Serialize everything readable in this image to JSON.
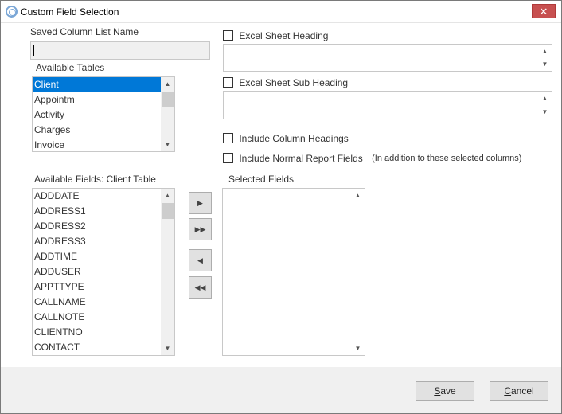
{
  "window": {
    "title": "Custom Field Selection",
    "close_glyph": "✕"
  },
  "saved_list": {
    "label": "Saved Column List Name",
    "value": ""
  },
  "tables": {
    "label": "Available Tables",
    "items": [
      "Client",
      "Appointm",
      "Activity",
      "Charges",
      "Invoice"
    ],
    "selected": "Client"
  },
  "fields": {
    "label": "Available Fields: Client Table",
    "items": [
      "ADDDATE",
      "ADDRESS1",
      "ADDRESS2",
      "ADDRESS3",
      "ADDTIME",
      "ADDUSER",
      "APPTTYPE",
      "CALLNAME",
      "CALLNOTE",
      "CLIENTNO",
      "CONTACT"
    ]
  },
  "selected_fields": {
    "label": "Selected Fields",
    "items": []
  },
  "options": {
    "excel_heading": {
      "label": "Excel Sheet Heading",
      "checked": false,
      "value": ""
    },
    "excel_sub_heading": {
      "label": "Excel Sheet Sub Heading",
      "checked": false,
      "value": ""
    },
    "include_column_headings": {
      "label": "Include Column Headings",
      "checked": false
    },
    "include_normal_fields": {
      "label": "Include Normal Report Fields",
      "checked": false,
      "note": "(In addition to these selected columns)"
    }
  },
  "move_buttons": {
    "add": "▶",
    "add_all": "▶▶",
    "remove": "◀",
    "remove_all": "◀◀"
  },
  "scroll_glyphs": {
    "up": "▲",
    "down": "▼"
  },
  "buttons": {
    "save": {
      "accel": "S",
      "rest": "ave"
    },
    "cancel": {
      "accel": "C",
      "rest": "ancel"
    }
  },
  "colors": {
    "selection": "#0078d7",
    "close": "#c75050"
  },
  "icons": [
    "app-icon",
    "close-icon",
    "checkbox-icon",
    "scroll-up-icon",
    "scroll-down-icon",
    "arrow-right-icon",
    "double-arrow-right-icon",
    "arrow-left-icon",
    "double-arrow-left-icon"
  ]
}
